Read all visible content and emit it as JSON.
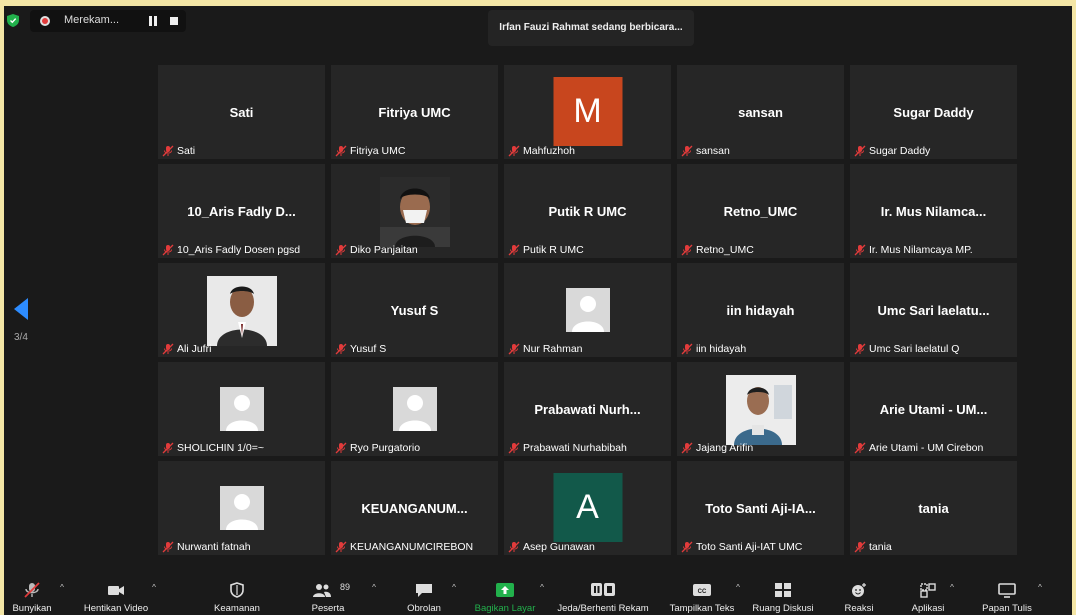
{
  "topbar": {
    "recording_label": "Merekam...",
    "speaker_banner": "Irfan Fauzi Rahmat sedang berbicara..."
  },
  "page_nav": {
    "page": "3/4"
  },
  "tiles": [
    {
      "name": "Sati",
      "label": "Sati",
      "type": "name"
    },
    {
      "name": "Fitriya UMC",
      "label": "Fitriya UMC",
      "type": "name"
    },
    {
      "name": "",
      "label": "Mahfuzhoh",
      "type": "letter",
      "letter": "M",
      "color": "#c8461e"
    },
    {
      "name": "sansan",
      "label": "sansan",
      "type": "name"
    },
    {
      "name": "Sugar Daddy",
      "label": "Sugar Daddy",
      "type": "name"
    },
    {
      "name": "10_Aris Fadly D...",
      "label": "10_Aris Fadly Dosen pgsd",
      "type": "name"
    },
    {
      "name": "",
      "label": "Diko Panjaitan",
      "type": "photo",
      "photo": "mask"
    },
    {
      "name": "Putik R UMC",
      "label": "Putik R UMC",
      "type": "name"
    },
    {
      "name": "Retno_UMC",
      "label": "Retno_UMC",
      "type": "name"
    },
    {
      "name": "Ir. Mus Nilamca...",
      "label": "Ir. Mus Nilamcaya MP.",
      "type": "name"
    },
    {
      "name": "",
      "label": "Ali Jufri",
      "type": "photo",
      "photo": "suit"
    },
    {
      "name": "Yusuf S",
      "label": "Yusuf S",
      "type": "name"
    },
    {
      "name": "",
      "label": "Nur Rahman",
      "type": "default"
    },
    {
      "name": "iin hidayah",
      "label": "iin hidayah",
      "type": "name"
    },
    {
      "name": "Umc Sari laelatu...",
      "label": "Umc Sari laelatul Q",
      "type": "name"
    },
    {
      "name": "",
      "label": "SHOLICHIN 1/0=~",
      "type": "default"
    },
    {
      "name": "",
      "label": "Ryo Purgatorio",
      "type": "default"
    },
    {
      "name": "Prabawati  Nurh...",
      "label": "Prabawati Nurhabibah",
      "type": "name"
    },
    {
      "name": "",
      "label": "Jajang Arifin",
      "type": "photo",
      "photo": "office"
    },
    {
      "name": "Arie Utami - UM...",
      "label": "Arie Utami - UM Cirebon",
      "type": "name"
    },
    {
      "name": "",
      "label": "Nurwanti fatnah",
      "type": "default"
    },
    {
      "name": "KEUANGANUM...",
      "label": "KEUANGANUMCIREBON",
      "type": "name"
    },
    {
      "name": "",
      "label": "Asep Gunawan",
      "type": "letter",
      "letter": "A",
      "color": "#12594a"
    },
    {
      "name": "Toto Santi Aji-IA...",
      "label": "Toto Santi Aji-IAT UMC",
      "type": "name"
    },
    {
      "name": "tania",
      "label": "tania",
      "type": "name"
    }
  ],
  "toolbar": {
    "unmute": "Bunyikan",
    "stop_video": "Hentikan Video",
    "security": "Keamanan",
    "participants": "Peserta",
    "participants_count": "89",
    "chat": "Obrolan",
    "share_screen": "Bagikan Layar",
    "pause_recording": "Jeda/Berhenti Rekam",
    "captions": "Tampilkan Teks",
    "breakout": "Ruang Diskusi",
    "reactions": "Reaksi",
    "apps": "Aplikasi",
    "whiteboard": "Papan Tulis"
  },
  "colors": {
    "accent_blue": "#2d8cff",
    "share_green": "#22b14c",
    "mic_off_red": "#e23b3b"
  }
}
